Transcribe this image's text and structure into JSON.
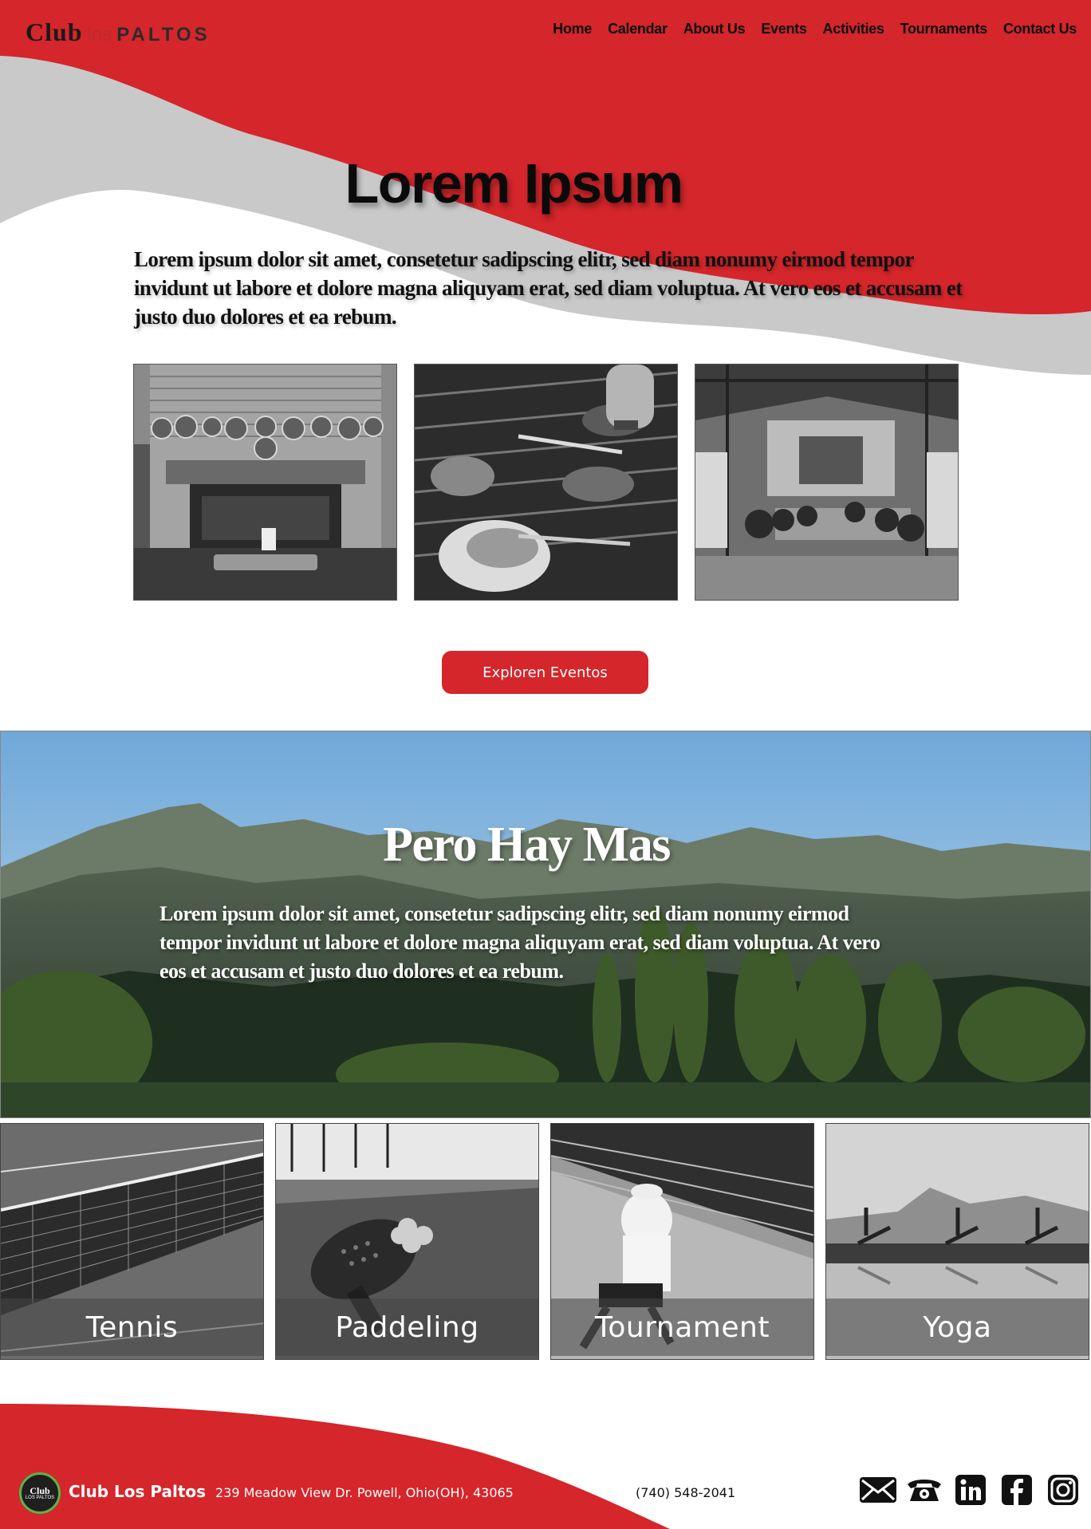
{
  "header": {
    "logo": {
      "part1": "Club",
      "part2": "los",
      "part3": "PALTOS"
    },
    "nav": [
      "Home",
      "Calendar",
      "About Us",
      "Events",
      "Activities",
      "Tournaments",
      "Contact Us"
    ]
  },
  "hero": {
    "title": "Lorem Ipsum",
    "text": "Lorem ipsum dolor sit amet, consetetur sadipscing elitr, sed diam nonumy eirmod tempor invidunt ut labore et dolore magna aliquyam erat, sed diam voluptua. At vero eos et accusam et justo duo dolores et ea rebum.",
    "cta_label": "Exploren Eventos"
  },
  "banner": {
    "title": "Pero Hay Mas",
    "text": "Lorem ipsum dolor sit amet, consetetur sadipscing elitr, sed diam nonumy eirmod tempor invidunt ut labore et dolore magna aliquyam erat, sed diam voluptua. At vero eos et accusam et justo duo dolores et ea rebum."
  },
  "activities": [
    {
      "label": "Tennis"
    },
    {
      "label": "Paddeling"
    },
    {
      "label": "Tournament"
    },
    {
      "label": "Yoga"
    }
  ],
  "footer": {
    "logo_text_top": "Club",
    "logo_text_bottom": "LOS PALTOS",
    "name": "Club Los Paltos",
    "address": "239 Meadow View Dr. Powell, Ohio(OH), 43065",
    "phone": "(740) 548-2041",
    "socials": [
      "mail-icon",
      "phone-icon",
      "linkedin-icon",
      "facebook-icon",
      "instagram-icon"
    ]
  },
  "colors": {
    "brand_red": "#d4262b",
    "wave_grey": "#c9c9c9"
  }
}
